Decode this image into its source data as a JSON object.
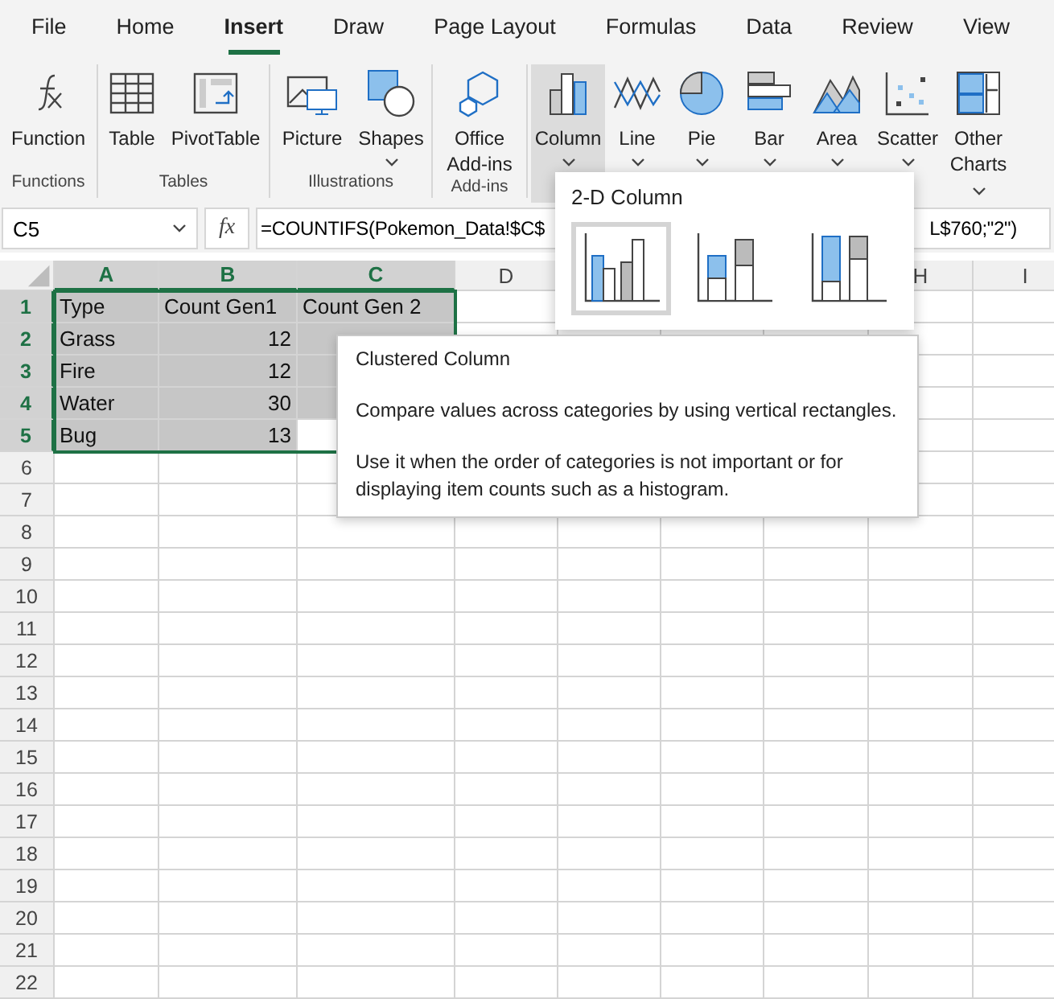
{
  "menu_tabs": [
    {
      "label": "File",
      "selected": false
    },
    {
      "label": "Home",
      "selected": false
    },
    {
      "label": "Insert",
      "selected": true
    },
    {
      "label": "Draw",
      "selected": false
    },
    {
      "label": "Page Layout",
      "selected": false
    },
    {
      "label": "Formulas",
      "selected": false
    },
    {
      "label": "Data",
      "selected": false
    },
    {
      "label": "Review",
      "selected": false
    },
    {
      "label": "View",
      "selected": false
    }
  ],
  "ribbon_groups": [
    {
      "label": "Functions",
      "buttons": [
        {
          "label": "Function"
        }
      ]
    },
    {
      "label": "Tables",
      "buttons": [
        {
          "label": "Table"
        },
        {
          "label": "PivotTable"
        }
      ]
    },
    {
      "label": "Illustrations",
      "buttons": [
        {
          "label": "Picture"
        },
        {
          "label": "Shapes",
          "dropdown": true
        }
      ]
    },
    {
      "label": "Add-ins",
      "buttons": [
        {
          "label": "Office Add-ins"
        }
      ]
    },
    {
      "buttons": [
        {
          "label": "Column",
          "dropdown": true,
          "selected": true
        },
        {
          "label": "Line",
          "dropdown": true,
          "selected": false
        },
        {
          "label": "Pie",
          "dropdown": true,
          "selected": false
        },
        {
          "label": "Bar",
          "dropdown": true,
          "selected": false
        },
        {
          "label": "Area",
          "dropdown": true,
          "selected": false
        },
        {
          "label": "Scatter",
          "dropdown": true,
          "selected": false
        },
        {
          "label": "Other Charts",
          "dropdown": true,
          "kind": "wrapped",
          "selected": false
        }
      ]
    }
  ],
  "formula_bar": {
    "name_box": "C5",
    "fx": "fx",
    "formula_start": "=COUNTIFS(Pokemon_Data!$C$",
    "formula_end": "L$760;\"2\")"
  },
  "columns": [
    {
      "label": "A",
      "selected": true
    },
    {
      "label": "B",
      "selected": true
    },
    {
      "label": "C",
      "selected": true
    },
    {
      "label": "D",
      "selected": false
    },
    null,
    null,
    null,
    {
      "label": "H",
      "selected": false
    },
    {
      "label": "I",
      "selected": false
    }
  ],
  "rows": [
    {
      "label": "1",
      "selected": true,
      "cells": [
        {
          "text": "Type",
          "kind": "text",
          "selected": true
        },
        {
          "text": "Count Gen1",
          "kind": "text",
          "selected": true
        },
        {
          "text": "Count Gen 2",
          "kind": "text",
          "selected": true
        }
      ]
    },
    {
      "label": "2",
      "selected": true,
      "cells": [
        {
          "text": "Grass",
          "kind": "text",
          "selected": true
        },
        {
          "text": "12",
          "kind": "number",
          "selected": true
        },
        {
          "selected": true
        }
      ]
    },
    {
      "label": "3",
      "selected": true,
      "cells": [
        {
          "text": "Fire",
          "kind": "text",
          "selected": true
        },
        {
          "text": "12",
          "kind": "number",
          "selected": true
        },
        {
          "selected": true
        }
      ]
    },
    {
      "label": "4",
      "selected": true,
      "cells": [
        {
          "text": "Water",
          "kind": "text",
          "selected": true
        },
        {
          "text": "30",
          "kind": "number",
          "selected": true
        },
        {
          "selected": true
        }
      ]
    },
    {
      "label": "5",
      "selected": true,
      "cells": [
        {
          "text": "Bug",
          "kind": "text",
          "selected": true
        },
        {
          "text": "13",
          "kind": "number",
          "selected": true
        },
        {
          "selected": false
        }
      ]
    },
    {
      "label": "6",
      "selected": false
    },
    {
      "label": "7",
      "selected": false
    },
    {
      "label": "8",
      "selected": false
    },
    {
      "label": "9",
      "selected": false
    },
    {
      "label": "10",
      "selected": false
    },
    {
      "label": "11",
      "selected": false
    },
    {
      "label": "12",
      "selected": false
    },
    {
      "label": "13",
      "selected": false
    },
    {
      "label": "14",
      "selected": false
    },
    {
      "label": "15",
      "selected": false
    },
    {
      "label": "16",
      "selected": false
    },
    {
      "label": "17",
      "selected": false
    },
    {
      "label": "18",
      "selected": false
    },
    {
      "label": "19",
      "selected": false
    },
    {
      "label": "20",
      "selected": false
    },
    {
      "label": "21",
      "selected": false
    },
    {
      "label": "22",
      "selected": false
    }
  ],
  "chart_menu": {
    "heading": "2-D Column",
    "options": [
      {
        "selected": true
      },
      {
        "selected": false
      },
      {
        "selected": false
      }
    ]
  },
  "tooltip": {
    "title": "Clustered Column",
    "paragraphs": [
      "Compare values across categories by using vertical rectangles.",
      "Use it when the order of categories is not important or for displaying item counts such as a histogram."
    ]
  }
}
